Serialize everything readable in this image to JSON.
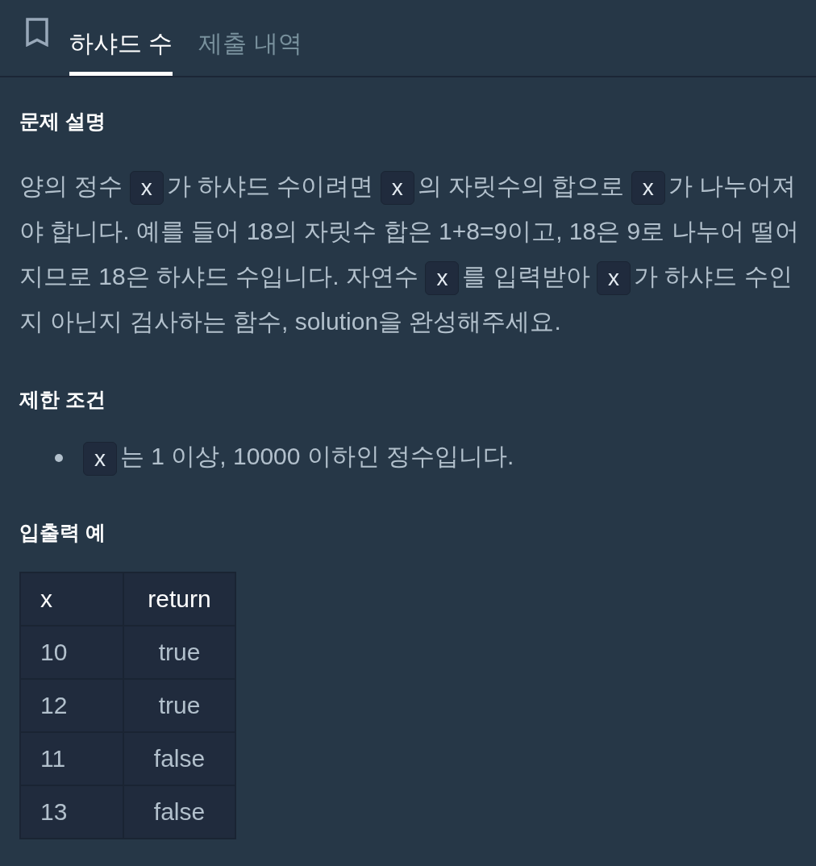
{
  "tabs": [
    {
      "label": "하샤드 수",
      "selected": true
    },
    {
      "label": "제출 내역",
      "selected": false
    }
  ],
  "sections": [
    {
      "kind": "paragraph",
      "heading": "문제 설명",
      "segments": [
        {
          "kind": "text",
          "text": "양의 정수 "
        },
        {
          "kind": "code",
          "text": "x"
        },
        {
          "kind": "text",
          "text": "가 하샤드 수이려면 "
        },
        {
          "kind": "code",
          "text": "x"
        },
        {
          "kind": "text",
          "text": "의 자릿수의 합으로 "
        },
        {
          "kind": "code",
          "text": "x"
        },
        {
          "kind": "text",
          "text": "가 나누어져야 합니다. 예를 들어 18의 자릿수 합은 1+8=9이고, 18은 9로 나누어 떨어지므로 18은 하샤드 수입니다. 자연수 "
        },
        {
          "kind": "code",
          "text": "x"
        },
        {
          "kind": "text",
          "text": "를 입력받아 "
        },
        {
          "kind": "code",
          "text": "x"
        },
        {
          "kind": "text",
          "text": "가 하샤드 수인지 아닌지 검사하는 함수, solution을 완성해주세요."
        }
      ]
    },
    {
      "kind": "list",
      "heading": "제한 조건",
      "items": [
        {
          "segments": [
            {
              "kind": "code",
              "text": "x"
            },
            {
              "kind": "text",
              "text": "는 1 이상, 10000 이하인 정수입니다."
            }
          ]
        }
      ]
    },
    {
      "kind": "table",
      "heading": "입출력 예",
      "columns": [
        "x",
        "return"
      ],
      "rows": [
        [
          "10",
          "true"
        ],
        [
          "12",
          "true"
        ],
        [
          "11",
          "false"
        ],
        [
          "13",
          "false"
        ]
      ]
    }
  ]
}
